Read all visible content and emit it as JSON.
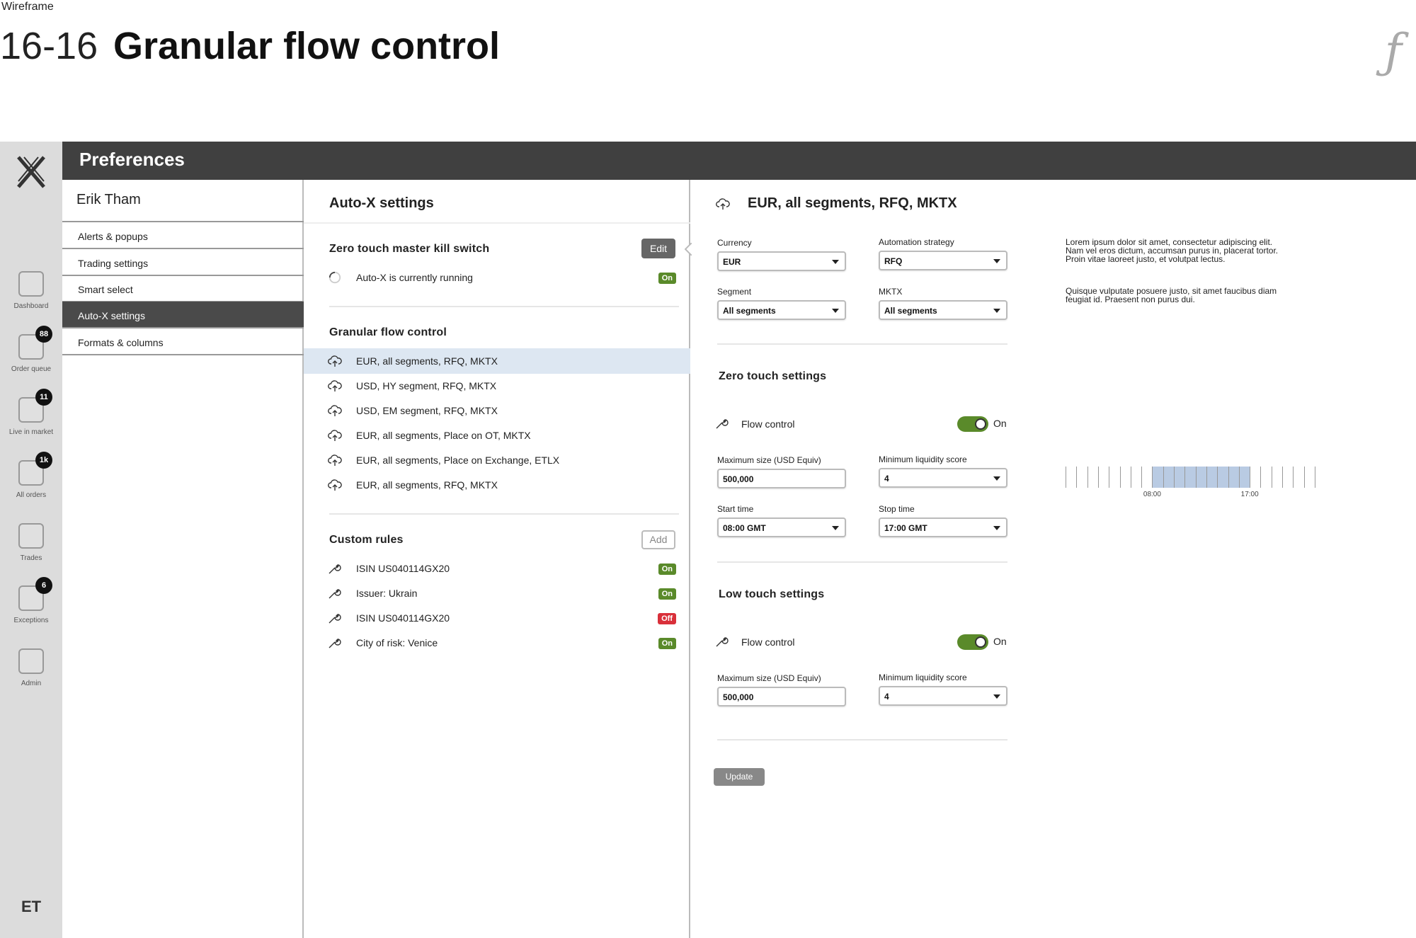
{
  "caption": "Wireframe",
  "title_number": "16-16",
  "title_text": "Granular flow control",
  "header": {
    "title": "Preferences"
  },
  "rail": {
    "items": [
      {
        "label": "Dashboard",
        "badge": ""
      },
      {
        "label": "Order queue",
        "badge": "88"
      },
      {
        "label": "Live in market",
        "badge": "11"
      },
      {
        "label": "All orders",
        "badge": "1k"
      },
      {
        "label": "Trades",
        "badge": ""
      },
      {
        "label": "Exceptions",
        "badge": "6"
      },
      {
        "label": "Admin",
        "badge": ""
      }
    ],
    "initials": "ET"
  },
  "sidebar": {
    "user": "Erik Tham",
    "items": [
      "Alerts & popups",
      "Trading settings",
      "Smart select",
      "Auto-X settings",
      "Formats & columns"
    ],
    "active_index": 3
  },
  "autox": {
    "title": "Auto-X settings",
    "kill_switch": {
      "title": "Zero touch master kill switch",
      "edit_label": "Edit",
      "status_text": "Auto-X is currently running",
      "status_pill": "On"
    },
    "flow": {
      "title": "Granular flow control",
      "items": [
        "EUR, all segments, RFQ, MKTX",
        "USD, HY segment, RFQ, MKTX",
        "USD, EM segment, RFQ, MKTX",
        "EUR, all segments, Place on OT, MKTX",
        "EUR, all segments, Place on Exchange, ETLX",
        "EUR, all segments, RFQ, MKTX"
      ]
    },
    "custom": {
      "title": "Custom rules",
      "add_label": "Add",
      "items": [
        {
          "label": "ISIN US040114GX20",
          "state": "On"
        },
        {
          "label": "Issuer: Ukrain",
          "state": "On"
        },
        {
          "label": "ISIN US040114GX20",
          "state": "Off"
        },
        {
          "label": "City of risk: Venice",
          "state": "On"
        }
      ]
    }
  },
  "detail": {
    "title": "EUR, all segments, RFQ, MKTX",
    "currency": {
      "label": "Currency",
      "value": "EUR"
    },
    "strategy": {
      "label": "Automation strategy",
      "value": "RFQ"
    },
    "segment": {
      "label": "Segment",
      "value": "All segments"
    },
    "mktx": {
      "label": "MKTX",
      "value": "All segments"
    },
    "zero_touch": {
      "title": "Zero touch settings",
      "flow_label": "Flow control",
      "toggle_label": "On",
      "max_size": {
        "label": "Maximum size (USD Equiv)",
        "value": "500,000"
      },
      "min_liq": {
        "label": "Minimum liquidity score",
        "value": "4"
      },
      "start": {
        "label": "Start time",
        "value": "08:00 GMT"
      },
      "stop": {
        "label": "Stop time",
        "value": "17:00 GMT"
      }
    },
    "low_touch": {
      "title": "Low touch settings",
      "flow_label": "Flow control",
      "toggle_label": "On",
      "max_size": {
        "label": "Maximum size (USD Equiv)",
        "value": "500,000"
      },
      "min_liq": {
        "label": "Minimum liquidity score",
        "value": "4"
      }
    },
    "update_label": "Update",
    "lorem_1": "Lorem ipsum dolor sit amet, consectetur adipiscing elit. Nam vel eros dictum, accumsan purus in, placerat tortor. Proin vitae laoreet justo, et volutpat lectus.",
    "lorem_2": "Quisque vulputate posuere justo, sit amet faucibus diam feugiat id. Praesent non purus dui.",
    "timeline": {
      "start_label": "08:00",
      "stop_label": "17:00",
      "total_ticks": 24,
      "active_from": 8,
      "active_to": 17
    },
    "colors": {
      "accent_on": "#5a8a2a",
      "accent_off": "#d9303a",
      "selected_row": "#dde7f2",
      "timeline_active": "#b9cbe3"
    }
  }
}
